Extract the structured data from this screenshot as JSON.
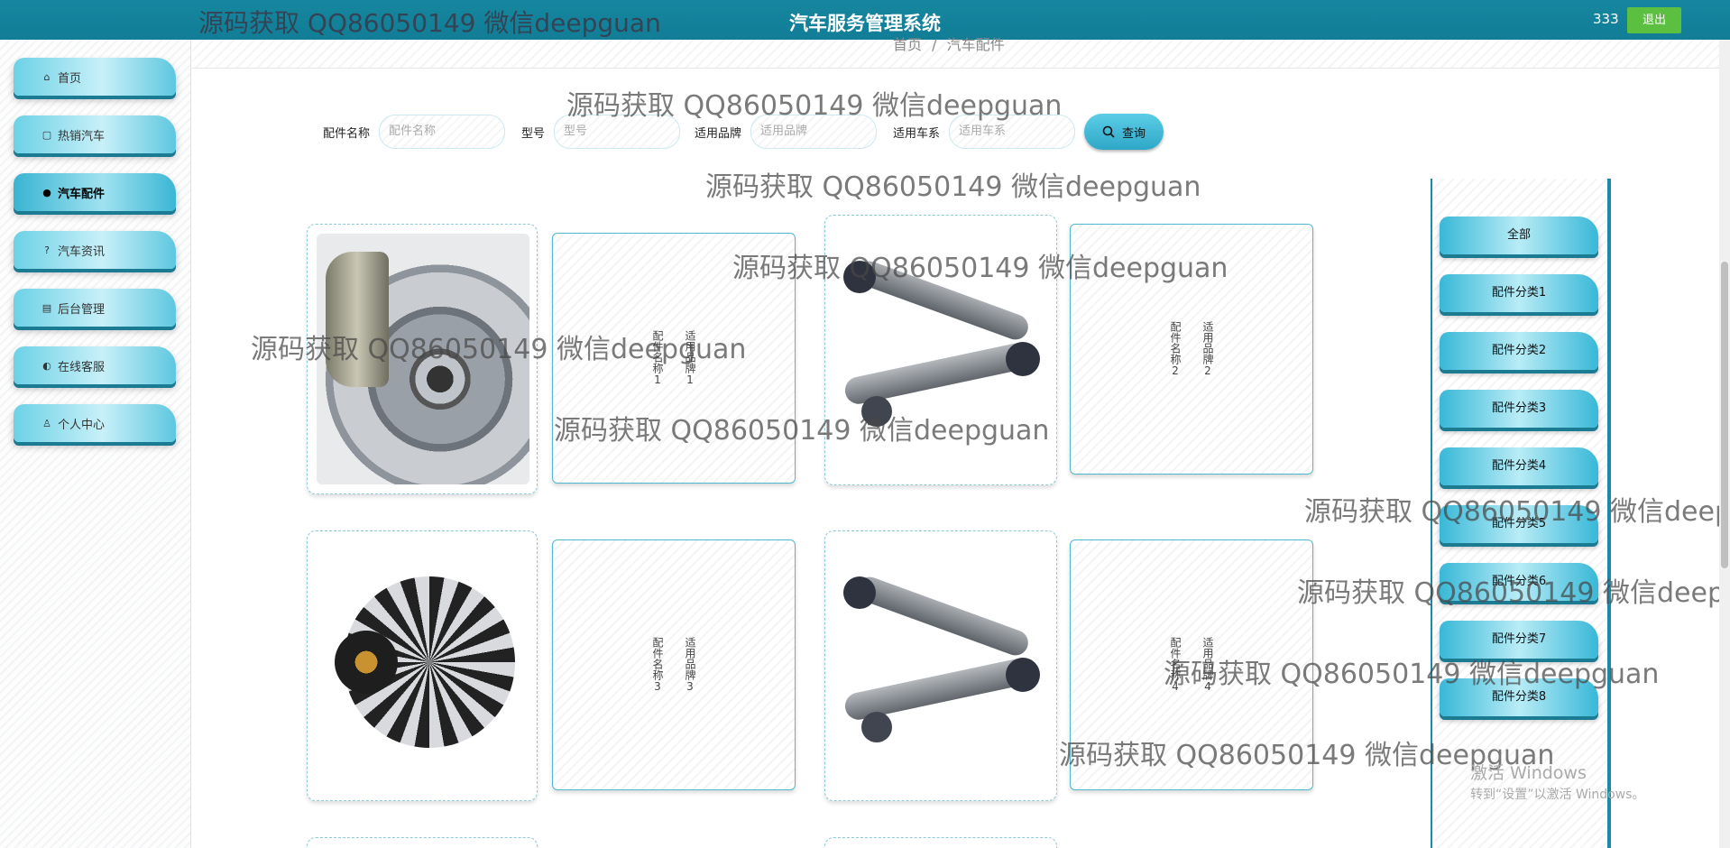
{
  "header": {
    "title": "汽车服务管理系统",
    "username": "333",
    "logout_label": "退出",
    "watermark": "源码获取 QQ86050149 微信deepguan"
  },
  "sidebar": {
    "items": [
      {
        "label": "首页",
        "icon": "home-icon",
        "glyph": "⌂"
      },
      {
        "label": "热销汽车",
        "icon": "bag-icon",
        "glyph": "▢"
      },
      {
        "label": "汽车配件",
        "icon": "info-circle-icon",
        "glyph": "●"
      },
      {
        "label": "汽车资讯",
        "icon": "question-circle-icon",
        "glyph": "?"
      },
      {
        "label": "后台管理",
        "icon": "store-icon",
        "glyph": "▤"
      },
      {
        "label": "在线客服",
        "icon": "headset-icon",
        "glyph": "◐"
      },
      {
        "label": "个人中心",
        "icon": "user-icon",
        "glyph": "♙"
      }
    ]
  },
  "breadcrumb": {
    "home": "首页",
    "sep": "/",
    "current": "汽车配件"
  },
  "search": {
    "fields": [
      {
        "label": "配件名称",
        "placeholder": "配件名称"
      },
      {
        "label": "型号",
        "placeholder": "型号"
      },
      {
        "label": "适用品牌",
        "placeholder": "适用品牌"
      },
      {
        "label": "适用车系",
        "placeholder": "适用车系"
      }
    ],
    "button_label": "查询"
  },
  "products": [
    {
      "name": "配件名称1",
      "brand": "适用品牌1",
      "image": "brake-disc-image"
    },
    {
      "name": "配件名称2",
      "brand": "适用品牌2",
      "image": "control-arm-image"
    },
    {
      "name": "配件名称3",
      "brand": "适用品牌3",
      "image": "alternator-image"
    },
    {
      "name": "配件名称4",
      "brand": "适用品牌4",
      "image": "control-arm-image"
    }
  ],
  "categories": [
    "全部",
    "配件分类1",
    "配件分类2",
    "配件分类3",
    "配件分类4",
    "配件分类5",
    "配件分类6",
    "配件分类7",
    "配件分类8"
  ],
  "os_notice": {
    "line1": "激活 Windows",
    "line2": "转到“设置”以激活 Windows。"
  }
}
